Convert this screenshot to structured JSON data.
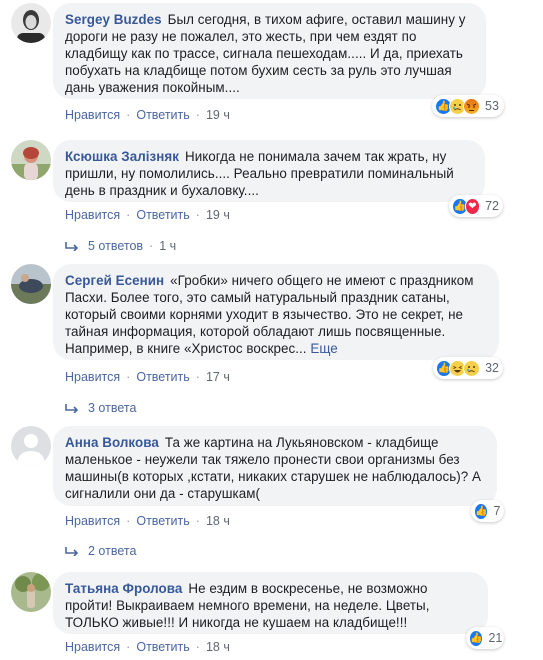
{
  "ui": {
    "dot": "·"
  },
  "comments": [
    {
      "author": "Sergey Buzdes",
      "text": "Был сегодня, в тихом афиге, оставил машину у дороги не разу не пожалел, это жесть, при чем ездят по кладбищу как по трассе, сигнала пешеходам..... И да, приехать побухать на кладбище потом бухим сесть за руль это лучшая дань уважения покойным....",
      "reactions": [
        "like-icon",
        "sad-icon",
        "angry-icon"
      ],
      "reaction_count": "53",
      "like_label": "Нравится",
      "reply_label": "Ответить",
      "time": "19 ч"
    },
    {
      "author": "Ксюшка Залізняк",
      "text": "Никогда не понимала зачем так жрать, ну пришли, ну помолились.... Реально превратили поминальный день в праздник и бухаловку....",
      "reactions": [
        "like-icon",
        "love-icon"
      ],
      "reaction_count": "72",
      "like_label": "Нравится",
      "reply_label": "Ответить",
      "time": "19 ч",
      "replies_label": "5 ответов",
      "replies_time": "1 ч"
    },
    {
      "author": "Сергей Есенин",
      "text": "«Гробки» ничего общего не имеют с праздником Пасхи. Более того, это самый натуральный праздник сатаны, который своими корнями уходит в язычество. Это не секрет, не тайная информация, которой обладают лишь посвященные. Например, в книге «Христос воскрес...",
      "more": "Еще",
      "reactions": [
        "like-icon",
        "haha-icon",
        "sad-icon"
      ],
      "reaction_count": "32",
      "like_label": "Нравится",
      "reply_label": "Ответить",
      "time": "17 ч",
      "replies_label": "3 ответа"
    },
    {
      "author": "Анна Волкова",
      "text": "Та же картина на Лукьяновском - кладбище маленькое - неужели так тяжело пронести свои организмы без машины(в которых ,кстати, никаких старушек не наблюдалось)? А сигналили они да - старушкам(",
      "reactions": [
        "like-icon"
      ],
      "reaction_count": "7",
      "like_label": "Нравится",
      "reply_label": "Ответить",
      "time": "18 ч",
      "replies_label": "2 ответа"
    },
    {
      "author": "Татьяна Фролова",
      "text": "Не ездим в воскресенье, не возможно пройти! Выкраиваем немного времени, на неделе. Цветы, ТОЛЬКО живые!!! И никогда не кушаем на кладбище!!!",
      "reactions": [
        "like-icon"
      ],
      "reaction_count": "21",
      "like_label": "Нравится",
      "reply_label": "Ответить",
      "time": "18 ч"
    }
  ]
}
